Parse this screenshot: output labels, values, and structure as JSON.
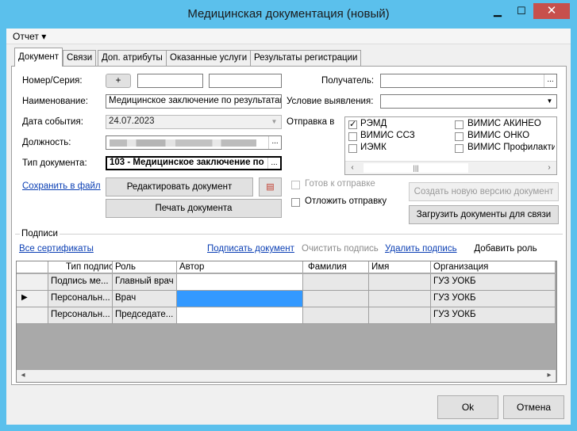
{
  "window": {
    "title": "Медицинская документация (новый)",
    "minimize": "▁",
    "maximize": "☐",
    "close": "✕"
  },
  "menu": {
    "report": "Отчет ▾"
  },
  "tabs": [
    {
      "label": "Документ"
    },
    {
      "label": "Связи"
    },
    {
      "label": "Доп. атрибуты"
    },
    {
      "label": "Оказанные услуги"
    },
    {
      "label": "Результаты регистрации"
    }
  ],
  "form": {
    "number_label": "Номер/Серия:",
    "plus_label": "+",
    "name_label": "Наименование:",
    "name_value": "Медицинское заключение по результатам",
    "date_label": "Дата события:",
    "date_value": "24.07.2023",
    "position_label": "Должность:",
    "doctype_label": "Тип документа:",
    "doctype_value": "103 - Медицинское заключение по",
    "recipient_label": "Получатель:",
    "condition_label": "Условие выявления:",
    "send_label": "Отправка в",
    "ellipsis": "..."
  },
  "send_targets": [
    {
      "label": "РЭМД",
      "checked": true
    },
    {
      "label": "ВИМИС АКИНЕО",
      "checked": false
    },
    {
      "label": "ВИМИС ССЗ",
      "checked": false
    },
    {
      "label": "ВИМИС ОНКО",
      "checked": false
    },
    {
      "label": "ИЭМК",
      "checked": false
    },
    {
      "label": "ВИМИС Профилактика",
      "checked": false
    }
  ],
  "actions": {
    "save_to_file": "Сохранить в файл",
    "edit_document": "Редактировать документ",
    "print_document": "Печать документа",
    "ready_to_send": "Готов к отправке",
    "postpone_send": "Отложить отправку",
    "create_new_version": "Создать новую версию документ",
    "load_documents": "Загрузить документы для связи"
  },
  "signatures": {
    "group_label": "Подписи",
    "all_certificates": "Все сертификаты",
    "sign_document": "Подписать документ",
    "clear_signature": "Очистить подпись",
    "delete_signature": "Удалить подпись",
    "add_role": "Добавить роль",
    "columns": [
      "Тип подписи",
      "Роль",
      "Автор",
      "Фамилия",
      "Имя",
      "Организация"
    ],
    "rows": [
      {
        "type": "Подпись ме...",
        "role": "Главный врач",
        "author": "",
        "last": "",
        "first": "",
        "org": "ГУЗ УОКБ"
      },
      {
        "type": "Персональн...",
        "role": "Врач",
        "author": "",
        "last": "",
        "first": "",
        "org": "ГУЗ УОКБ"
      },
      {
        "type": "Персональн...",
        "role": "Председате...",
        "author": "",
        "last": "",
        "first": "",
        "org": "ГУЗ УОКБ"
      }
    ]
  },
  "footer": {
    "ok": "Ok",
    "cancel": "Отмена"
  },
  "colors": {
    "titlebar": "#5bc0ec",
    "selection": "#3399ff",
    "link": "#0b3fb4"
  }
}
